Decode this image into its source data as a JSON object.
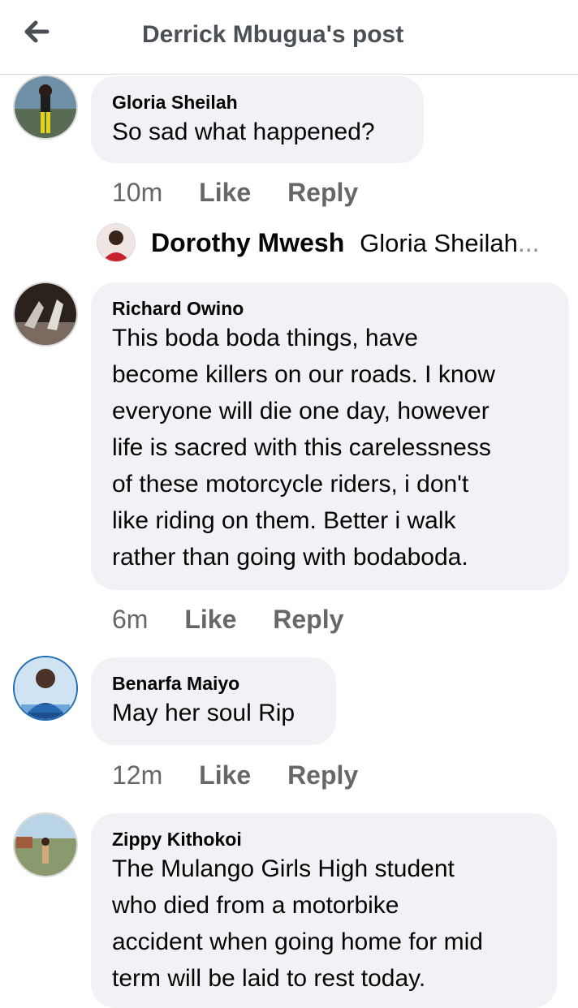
{
  "header": {
    "title": "Derrick Mbugua's post"
  },
  "comments": [
    {
      "author": "Gloria Sheilah",
      "lines": [
        "So sad what happened?"
      ],
      "time": "10m",
      "like": "Like",
      "reply": "Reply"
    },
    {
      "author": "Richard Owino",
      "lines": [
        "This boda boda things, have",
        "become killers on our roads. I know",
        "everyone will die one day, however",
        "life is sacred with this carelessness",
        "of these motorcycle riders, i don't",
        "like riding on them. Better i walk",
        "rather than going with bodaboda."
      ],
      "time": "6m",
      "like": "Like",
      "reply": "Reply"
    },
    {
      "author": "Benarfa Maiyo",
      "lines": [
        "May her soul Rip"
      ],
      "time": "12m",
      "like": "Like",
      "reply": "Reply"
    },
    {
      "author": "Zippy Kithokoi",
      "lines": [
        "The Mulango Girls High student",
        "who died from a motorbike",
        "accident when going home for mid",
        "term will be laid to rest today."
      ]
    }
  ],
  "reply_preview": {
    "author": "Dorothy Mwesh",
    "text": "Gloria Sheilah",
    "ellipsis": "..."
  }
}
